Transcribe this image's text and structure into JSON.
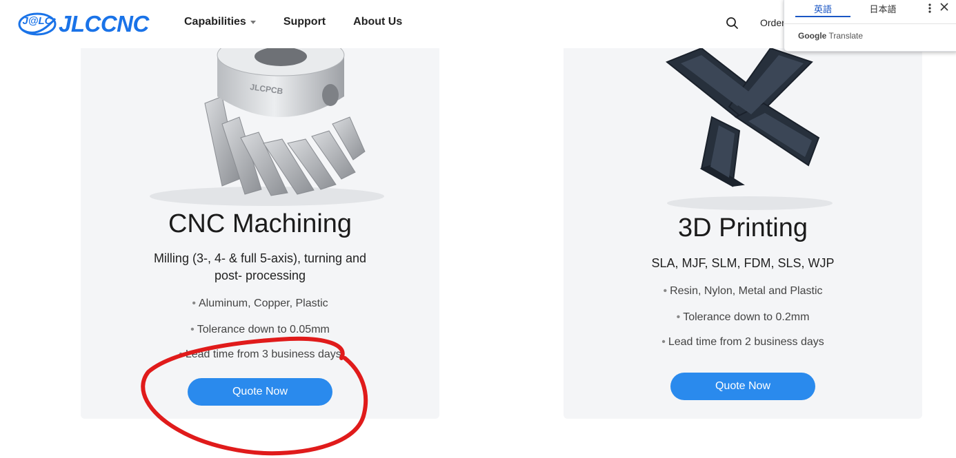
{
  "header": {
    "brand": "JLCCNC",
    "brand_badge": "J@LC",
    "nav": [
      {
        "label": "Capabilities"
      },
      {
        "label": "Support"
      },
      {
        "label": "About Us"
      }
    ],
    "orders_label": "Orders"
  },
  "translate_popup": {
    "tabs": [
      "英語",
      "日本語"
    ],
    "brand_google": "Google",
    "brand_translate": "Translate"
  },
  "cards": [
    {
      "title": "CNC Machining",
      "subtitle_lines": [
        "Milling (3-, 4- & full 5-axis), turning and",
        "post- processing"
      ],
      "features": [
        "Aluminum, Copper, Plastic",
        "Tolerance down to 0.05mm",
        "Lead time from 3 business days"
      ],
      "button": "Quote Now",
      "image_text": "JLCPCB"
    },
    {
      "title": "3D Printing",
      "subtitle_lines": [
        "SLA, MJF, SLM, FDM, SLS, WJP"
      ],
      "features": [
        "Resin, Nylon, Metal and Plastic",
        "Tolerance down to 0.2mm",
        "Lead time from 2 business days"
      ],
      "button": "Quote Now"
    }
  ],
  "colors": {
    "brand_blue": "#1a73e8",
    "button_blue": "#2a8aed",
    "card_bg": "#f4f5f7",
    "annotation_red": "#e01b1b"
  },
  "icons": [
    "search-icon",
    "caret-down-icon",
    "more-vert-icon",
    "close-icon"
  ]
}
